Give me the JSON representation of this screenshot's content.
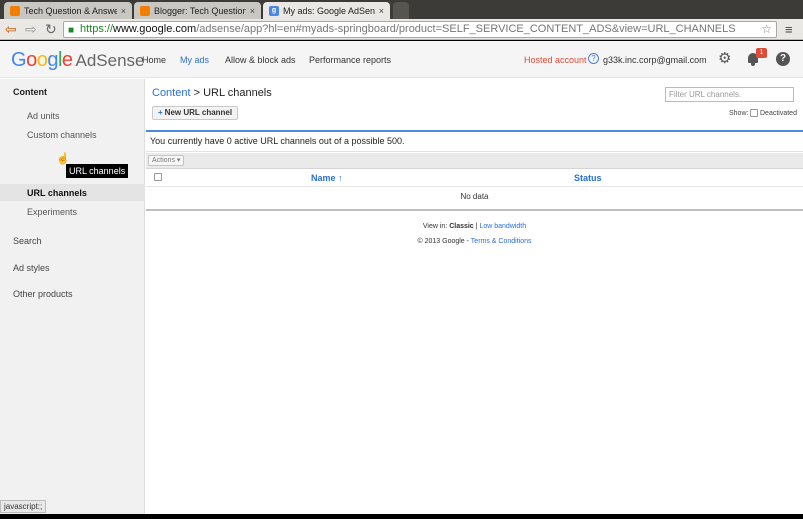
{
  "browser": {
    "tabs": [
      {
        "title": "Tech Question & Answer",
        "close": "×"
      },
      {
        "title": "Blogger: Tech Question &",
        "close": "×"
      },
      {
        "title": "My ads: Google AdSense",
        "close": "×"
      }
    ],
    "url_scheme": "https://",
    "url_host": "www.google.com",
    "url_path": "/adsense/app?hl=en#myads-springboard/product=SELF_SERVICE_CONTENT_ADS&view=URL_CHANNELS",
    "back_glyph": "⇦",
    "forward_glyph": "⇨",
    "reload_glyph": "↻",
    "star_glyph": "☆",
    "menu_glyph": "≡",
    "lock_glyph": "🔒",
    "status_text": "javascript:;"
  },
  "header": {
    "logo_letters": [
      "G",
      "o",
      "o",
      "g",
      "l",
      "e"
    ],
    "product": "AdSense",
    "nav": [
      "Home",
      "My ads",
      "Allow & block ads",
      "Performance reports"
    ],
    "hosted": "Hosted account",
    "help_small": "?",
    "email": "g33k.inc.corp@gmail.com",
    "gear_glyph": "⚙",
    "notifications_count": "1",
    "help_big": "?"
  },
  "sidebar": {
    "content_label": "Content",
    "sub_items": [
      "Ad units",
      "Custom channels",
      "URL channels",
      "Experiments"
    ],
    "other": [
      "Search",
      "Ad styles",
      "Other products"
    ],
    "tooltip": "URL channels",
    "cursor_glyph": "☝"
  },
  "main": {
    "breadcrumb_link": "Content",
    "breadcrumb_rest": " > URL channels",
    "filter_placeholder": "Filter URL channels.",
    "new_button_plus": "+",
    "new_button_label": "New URL channel",
    "show_label": "Show:",
    "deactivated_label": "Deactivated",
    "info_text": "You currently have 0 active URL channels out of a possible 500.",
    "actions_label": "Actions ▾",
    "col_name": "Name ↑",
    "col_status": "Status",
    "no_data": "No data",
    "view_in": "View in: ",
    "classic": "Classic",
    "sep": " | ",
    "low_bandwidth": "Low bandwidth",
    "copyright": "© 2013 Google - ",
    "terms": "Terms & Conditions"
  },
  "colors": {
    "accent": "#2a6fd6",
    "brand_red": "#dd4b39"
  }
}
